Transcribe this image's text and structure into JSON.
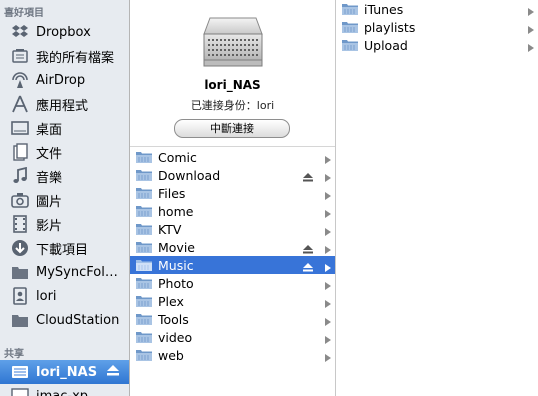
{
  "sidebar": {
    "favorites_title": "喜好項目",
    "favorites": [
      {
        "label": "Dropbox",
        "icon": "dropbox-icon"
      },
      {
        "label": "我的所有檔案",
        "icon": "all-files-icon"
      },
      {
        "label": "AirDrop",
        "icon": "airdrop-icon"
      },
      {
        "label": "應用程式",
        "icon": "applications-icon"
      },
      {
        "label": "桌面",
        "icon": "desktop-icon"
      },
      {
        "label": "文件",
        "icon": "documents-icon"
      },
      {
        "label": "音樂",
        "icon": "music-icon"
      },
      {
        "label": "圖片",
        "icon": "pictures-icon"
      },
      {
        "label": "影片",
        "icon": "movies-icon"
      },
      {
        "label": "下載項目",
        "icon": "downloads-icon"
      },
      {
        "label": "MySyncFol…",
        "icon": "folder-icon"
      },
      {
        "label": "lori",
        "icon": "home-icon"
      },
      {
        "label": "CloudStation",
        "icon": "folder-icon"
      }
    ],
    "shared_title": "共享",
    "shared": [
      {
        "label": "lori_NAS",
        "icon": "server-icon",
        "selected": true,
        "ejectable": true
      },
      {
        "label": "imac-xp",
        "icon": "pc-icon"
      }
    ]
  },
  "device": {
    "name": "lori_NAS",
    "status": "已連接身份：lori",
    "disconnect_label": "中斷連接",
    "icon": "server-icon"
  },
  "shares": [
    {
      "label": "Comic",
      "ejectable": false
    },
    {
      "label": "Download",
      "ejectable": true
    },
    {
      "label": "Files",
      "ejectable": false
    },
    {
      "label": "home",
      "ejectable": false
    },
    {
      "label": "KTV",
      "ejectable": false
    },
    {
      "label": "Movie",
      "ejectable": true
    },
    {
      "label": "Music",
      "ejectable": true,
      "selected": true
    },
    {
      "label": "Photo",
      "ejectable": false
    },
    {
      "label": "Plex",
      "ejectable": false
    },
    {
      "label": "Tools",
      "ejectable": false
    },
    {
      "label": "video",
      "ejectable": false
    },
    {
      "label": "web",
      "ejectable": false
    }
  ],
  "music_contents": [
    {
      "label": "iTunes"
    },
    {
      "label": "playlists"
    },
    {
      "label": "Upload"
    }
  ],
  "colors": {
    "sidebar_bg": "#e7ebf0",
    "selection_blue": "#3874d8",
    "folder_blue": "#7fa6cf"
  }
}
